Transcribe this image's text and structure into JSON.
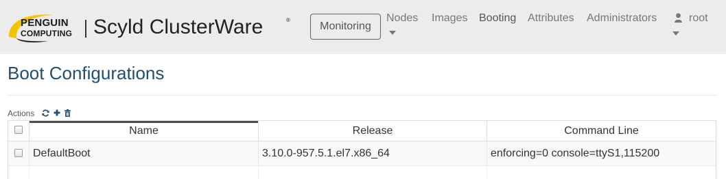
{
  "brand": {
    "company_line1": "PENGUIN",
    "company_line2": "COMPUTING",
    "product": "Scyld ClusterWare",
    "registered_mark": "®"
  },
  "nav": {
    "monitoring_button": "Monitoring",
    "links": {
      "nodes": "Nodes",
      "images": "Images",
      "booting": "Booting",
      "attributes": "Attributes",
      "administrators": "Administrators"
    },
    "active": "Booting",
    "user": "root"
  },
  "page": {
    "title": "Boot Configurations"
  },
  "actions": {
    "label": "Actions",
    "icons": [
      "refresh-icon",
      "add-icon",
      "delete-icon"
    ]
  },
  "table": {
    "columns": [
      "Name",
      "Release",
      "Command Line"
    ],
    "sorted_column": "Name",
    "rows": [
      {
        "name": "DefaultBoot",
        "release": "3.10.0-957.5.1.el7.x86_64",
        "command_line": "enforcing=0 console=ttyS1,115200",
        "selected": false
      }
    ]
  },
  "colors": {
    "navbar_bg": "#ececec",
    "title": "#1f4e74",
    "nav_link": "#777777",
    "action_icons": "#1f4e74",
    "logo_swoosh": "#f5c400"
  }
}
